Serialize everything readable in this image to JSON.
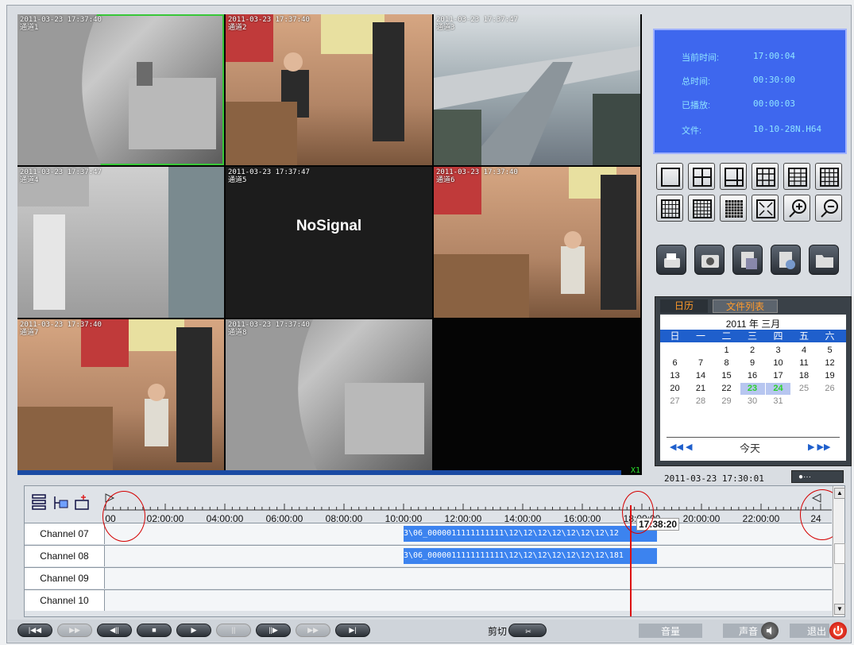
{
  "video_tiles": [
    {
      "timestamp": "2011-03-23 17:37:40",
      "channel": "通道1",
      "active": true
    },
    {
      "timestamp": "2011-03-23 17:37:40",
      "channel": "通道2"
    },
    {
      "timestamp": "2011-03-23 17:37:47",
      "channel": "通道3"
    },
    {
      "timestamp": "2011-03-23 17:37:47",
      "channel": "通道4"
    },
    {
      "timestamp": "2011-03-23 17:37:47",
      "channel": "通道5",
      "status": "NoSignal"
    },
    {
      "timestamp": "2011-03-23 17:37:40",
      "channel": "通道6"
    },
    {
      "timestamp": "2011-03-23 17:37:40",
      "channel": "通道7"
    },
    {
      "timestamp": "2011-03-23 17:37:40",
      "channel": "通道8"
    },
    {
      "timestamp": "",
      "channel": ""
    }
  ],
  "zoom_label": "X1",
  "info_panel": {
    "current_time_label": "当前时间:",
    "current_time": "17:00:04",
    "total_time_label": "总时间:",
    "total_time": "00:30:00",
    "played_label": "已播放:",
    "played": "00:00:03",
    "file_label": "文件:",
    "file": "10-10-28N.H64"
  },
  "layout_buttons": [
    "layout-1-icon",
    "layout-4-icon",
    "layout-6-icon",
    "layout-9-icon",
    "layout-12-icon",
    "layout-16-icon",
    "layout-20-icon",
    "layout-25-icon",
    "layout-36-icon",
    "fullscreen-icon",
    "zoom-in-icon",
    "zoom-out-icon"
  ],
  "action_buttons": [
    "backup-icon",
    "snapshot-icon",
    "export-icon",
    "convert-icon",
    "open-folder-icon"
  ],
  "calendar": {
    "tabs": [
      "日历",
      "文件列表"
    ],
    "year": "2011",
    "year_suffix": "年",
    "month": "三月",
    "weekdays": [
      "日",
      "一",
      "二",
      "三",
      "四",
      "五",
      "六"
    ],
    "weeks": [
      [
        "",
        "",
        "1",
        "2",
        "3",
        "4",
        "5"
      ],
      [
        "6",
        "7",
        "8",
        "9",
        "10",
        "11",
        "12"
      ],
      [
        "13",
        "14",
        "15",
        "16",
        "17",
        "18",
        "19"
      ],
      [
        "20",
        "21",
        "22",
        "23",
        "24",
        "25",
        "26"
      ],
      [
        "27",
        "28",
        "29",
        "30",
        "31",
        "",
        ""
      ]
    ],
    "highlighted": [
      "23",
      "24"
    ],
    "muted": [
      "25",
      "26",
      "27",
      "28",
      "29",
      "30",
      "31"
    ],
    "today_label": "今天",
    "nav_prev": "◀◀  ◀",
    "nav_next": "▶  ▶▶"
  },
  "datetime": "2011-03-23 17:30:01",
  "datetime_btn": "●···",
  "timeline": {
    "ticks": [
      "00",
      "02:00:00",
      "04:00:00",
      "06:00:00",
      "08:00:00",
      "10:00:00",
      "12:00:00",
      "14:00:00",
      "16:00:00",
      "18:00:00",
      "20:00:00",
      "22:00:00",
      "24"
    ],
    "cursor_time": "17:38:20",
    "channels": [
      {
        "name": "Channel 07",
        "segment": "3\\06_0000011111111111\\12\\12\\12\\12\\12\\12\\12\\12",
        "start_hour": 10.0,
        "end_hour": 18.5
      },
      {
        "name": "Channel 08",
        "segment": "3\\06_0000011111111111\\12\\12\\12\\12\\12\\12\\12\\181",
        "start_hour": 10.0,
        "end_hour": 18.5
      },
      {
        "name": "Channel 09",
        "segment": ""
      },
      {
        "name": "Channel 10",
        "segment": ""
      }
    ],
    "cursor_hour": 17.6
  },
  "transport": {
    "buttons": [
      "|◀◀",
      "▶▶",
      "◀||",
      "■",
      "▶",
      "||",
      "||▶",
      "▶▶",
      "▶|"
    ],
    "cut_label": "剪切",
    "volume_label": "音量",
    "sound_label": "声音",
    "exit_label": "退出"
  }
}
